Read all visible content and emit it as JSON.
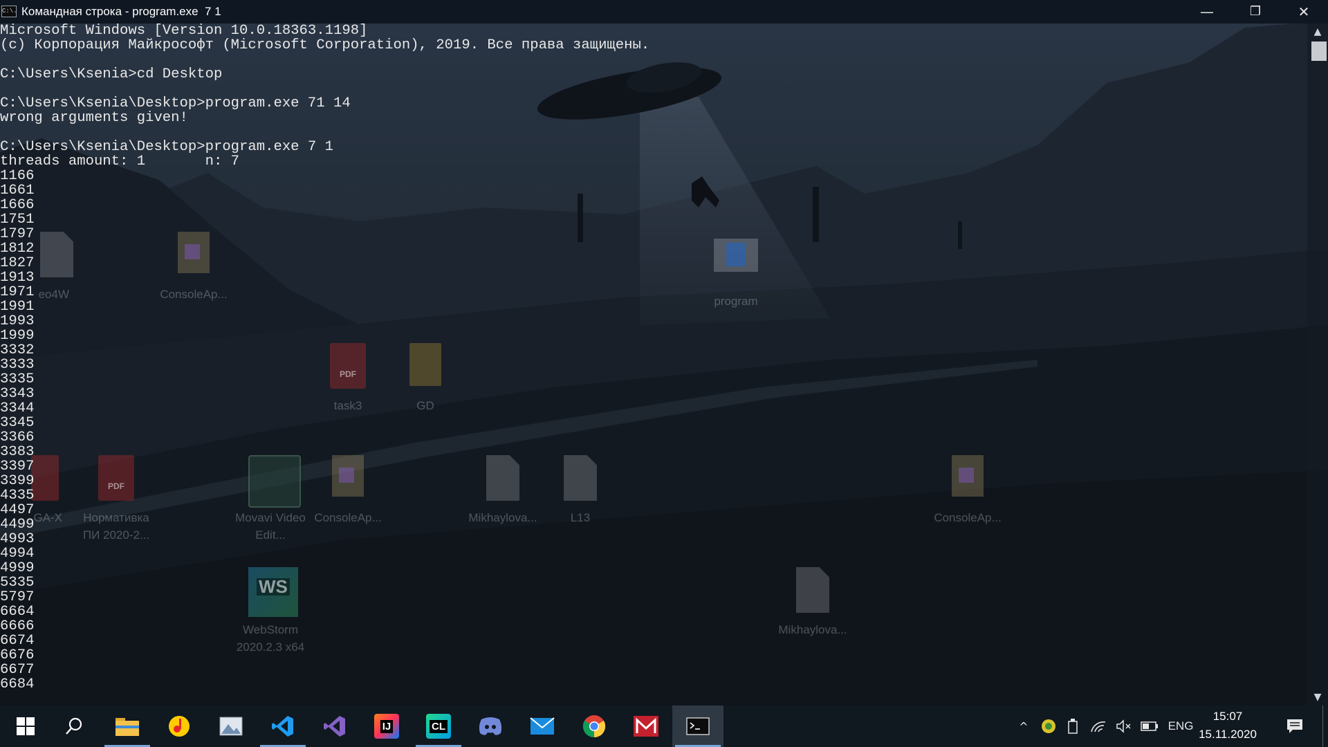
{
  "window": {
    "title": "Командная строка - program.exe  7 1",
    "icon_label": "C:\\.",
    "controls": {
      "minimize": "—",
      "restore": "❐",
      "close": "✕"
    }
  },
  "console": {
    "lines": [
      "Microsoft Windows [Version 10.0.18363.1198]",
      "(c) Корпорация Майкрософт (Microsoft Corporation), 2019. Все права защищены.",
      "",
      "C:\\Users\\Ksenia>cd Desktop",
      "",
      "C:\\Users\\Ksenia\\Desktop>program.exe 71 14",
      "wrong arguments given!",
      "",
      "C:\\Users\\Ksenia\\Desktop>program.exe 7 1",
      "threads amount: 1       n: 7",
      "1166",
      "1661",
      "1666",
      "1751",
      "1797",
      "1812",
      "1827",
      "1913",
      "1971",
      "1991",
      "1993",
      "1999",
      "3332",
      "3333",
      "3335",
      "3343",
      "3344",
      "3345",
      "3366",
      "3383",
      "3397",
      "3399",
      "4335",
      "4497",
      "4499",
      "4993",
      "4994",
      "4999",
      "5335",
      "5797",
      "6664",
      "6666",
      "6674",
      "6676",
      "6677",
      "6684"
    ]
  },
  "scrollbar": {
    "up": "▲",
    "down": "▼",
    "position": 0.0
  },
  "desktop_icons": [
    {
      "id": "consoleapp-1",
      "label": "ConsoleAp...",
      "kind": "vsproj"
    },
    {
      "id": "program",
      "label": "program",
      "kind": "prog"
    },
    {
      "id": "task3",
      "label": "task3",
      "kind": "pdf"
    },
    {
      "id": "gd",
      "label": "GD",
      "kind": "folder"
    },
    {
      "id": "normativka",
      "label": "Нормативка ПИ 2020-2...",
      "kind": "pdf"
    },
    {
      "id": "movavi",
      "label": "Movavi Video Edit...",
      "kind": "movavi"
    },
    {
      "id": "consoleapp-2",
      "label": "ConsoleAp...",
      "kind": "vsproj"
    },
    {
      "id": "mikhaylova-1",
      "label": "Mikhaylova...",
      "kind": "doc"
    },
    {
      "id": "l13",
      "label": "L13",
      "kind": "doc"
    },
    {
      "id": "consoleapp-3",
      "label": "ConsoleAp...",
      "kind": "vsproj"
    },
    {
      "id": "webstorm",
      "label": "WebStorm 2020.2.3 x64",
      "kind": "ws"
    },
    {
      "id": "mikhaylova-2",
      "label": "Mikhaylova...",
      "kind": "doc"
    }
  ],
  "partial_icon_labels": {
    "video": "eo4W",
    "gax": "GA-X"
  },
  "pdf_badge": "PDF",
  "webstorm_badge": "WS",
  "taskbar": {
    "apps": [
      {
        "name": "start",
        "icon": "windows-logo-icon"
      },
      {
        "name": "search",
        "icon": "search-icon"
      },
      {
        "name": "file-explorer",
        "icon": "folder-icon",
        "open": true
      },
      {
        "name": "music-player",
        "icon": "music-icon"
      },
      {
        "name": "image-viewer",
        "icon": "picture-icon"
      },
      {
        "name": "vscode",
        "icon": "vscode-icon"
      },
      {
        "name": "visual-studio",
        "icon": "visual-studio-icon"
      },
      {
        "name": "intellij",
        "icon": "intellij-icon",
        "badge": "IJ"
      },
      {
        "name": "clion",
        "icon": "clion-icon",
        "badge": "CL",
        "open": true
      },
      {
        "name": "discord",
        "icon": "discord-icon"
      },
      {
        "name": "mail",
        "icon": "mail-icon"
      },
      {
        "name": "chrome",
        "icon": "chrome-icon"
      },
      {
        "name": "mendeley",
        "icon": "mendeley-icon"
      },
      {
        "name": "command-prompt",
        "icon": "cmd-icon",
        "open": true,
        "active": true
      }
    ],
    "tray": {
      "chevron": "^",
      "language": "ENG",
      "time": "15:07",
      "date": "15.11.2020"
    }
  }
}
